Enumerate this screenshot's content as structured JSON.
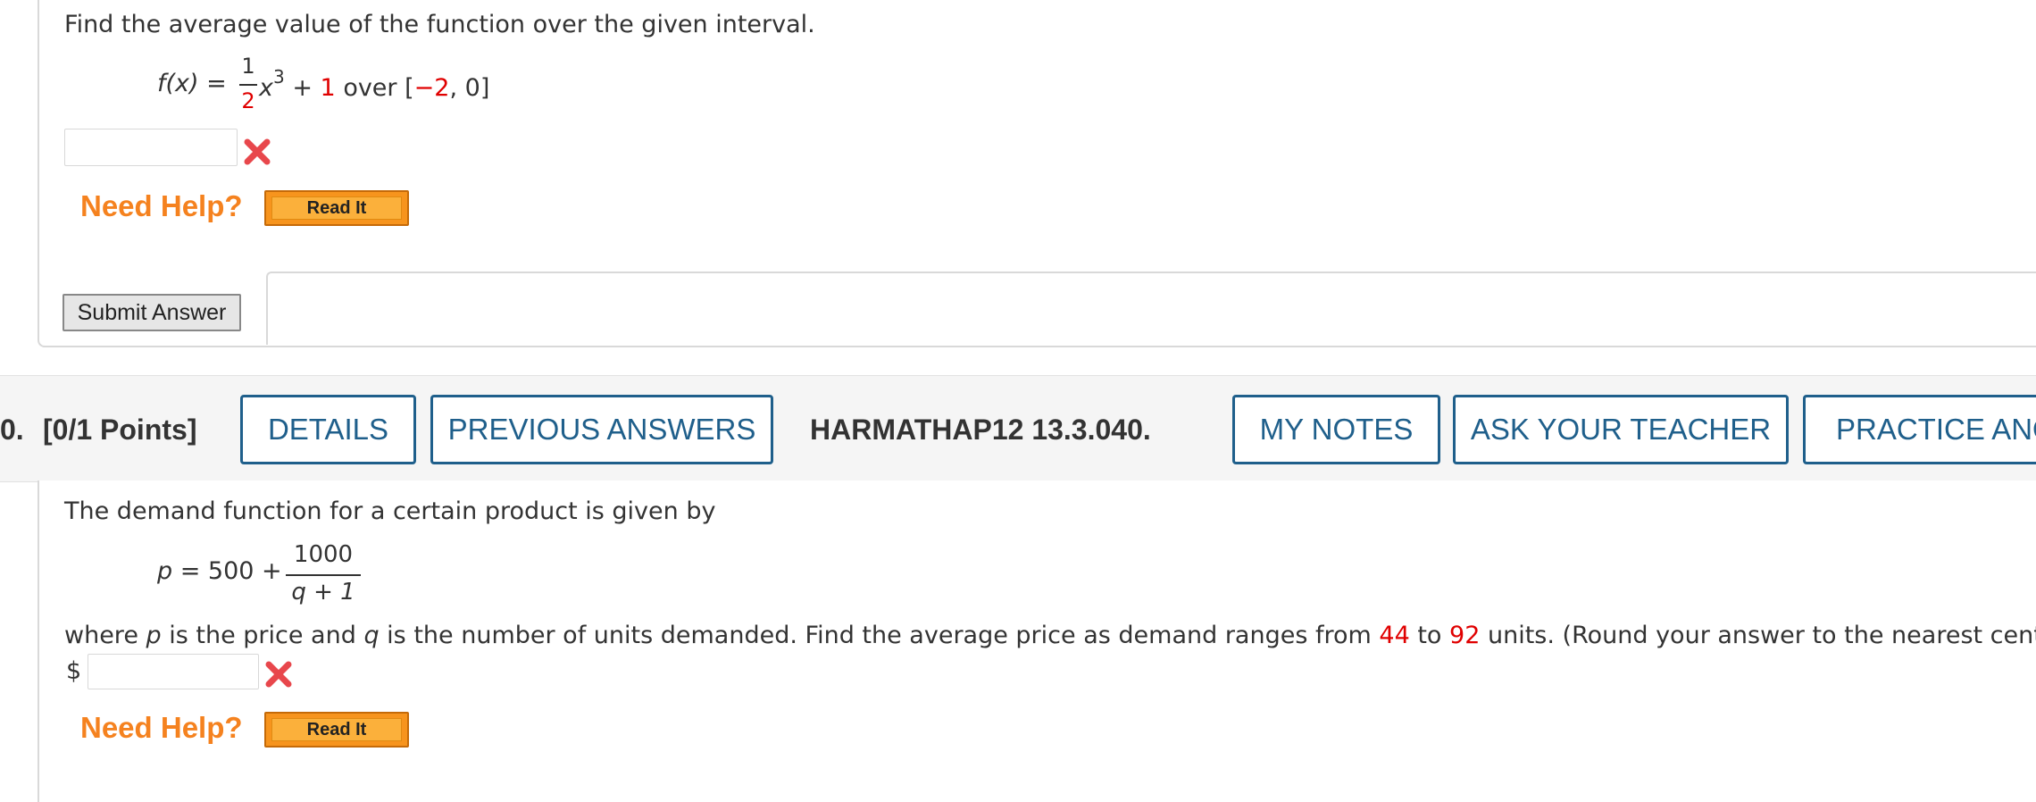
{
  "q1": {
    "prompt": "Find the average value of the function over the given interval.",
    "function_lhs": "f(x) =",
    "frac_num": "1",
    "frac_den": "2",
    "x_var": "x",
    "exponent": "3",
    "plus": "+",
    "constant": "1",
    "over_text": "over",
    "interval_open": "[",
    "interval_a": "−2",
    "interval_sep": ", 0]",
    "answer_value": "",
    "need_help": "Need Help?",
    "read_it": "Read It",
    "submit": "Submit Answer"
  },
  "header": {
    "number": "0.",
    "points": "[0/1 Points]",
    "details": "DETAILS",
    "previous_answers": "PREVIOUS ANSWERS",
    "problem_id": "HARMATHAP12 13.3.040.",
    "my_notes": "MY NOTES",
    "ask_teacher": "ASK YOUR TEACHER",
    "practice": "PRACTICE ANO"
  },
  "q2": {
    "prompt": "The demand function for a certain product is given by",
    "lhs": "p",
    "eq": " = 500 +",
    "frac_num": "1000",
    "frac_den": "q + 1",
    "desc_1": "where ",
    "desc_p": "p",
    "desc_2": " is the price and ",
    "desc_q": "q",
    "desc_3": " is the number of units demanded. Find the average price as demand ranges from ",
    "low": "44",
    "desc_to": " to ",
    "high": "92",
    "desc_4": " units. (Round your answer to the nearest cent.)",
    "currency": "$",
    "answer_value": "",
    "need_help": "Need Help?",
    "read_it": "Read It"
  },
  "colors": {
    "accent_blue": "#1f5f8b",
    "help_orange": "#f5821f",
    "given_red": "#e00000",
    "error_red": "#e8474c"
  },
  "icons": [
    "close-icon"
  ]
}
